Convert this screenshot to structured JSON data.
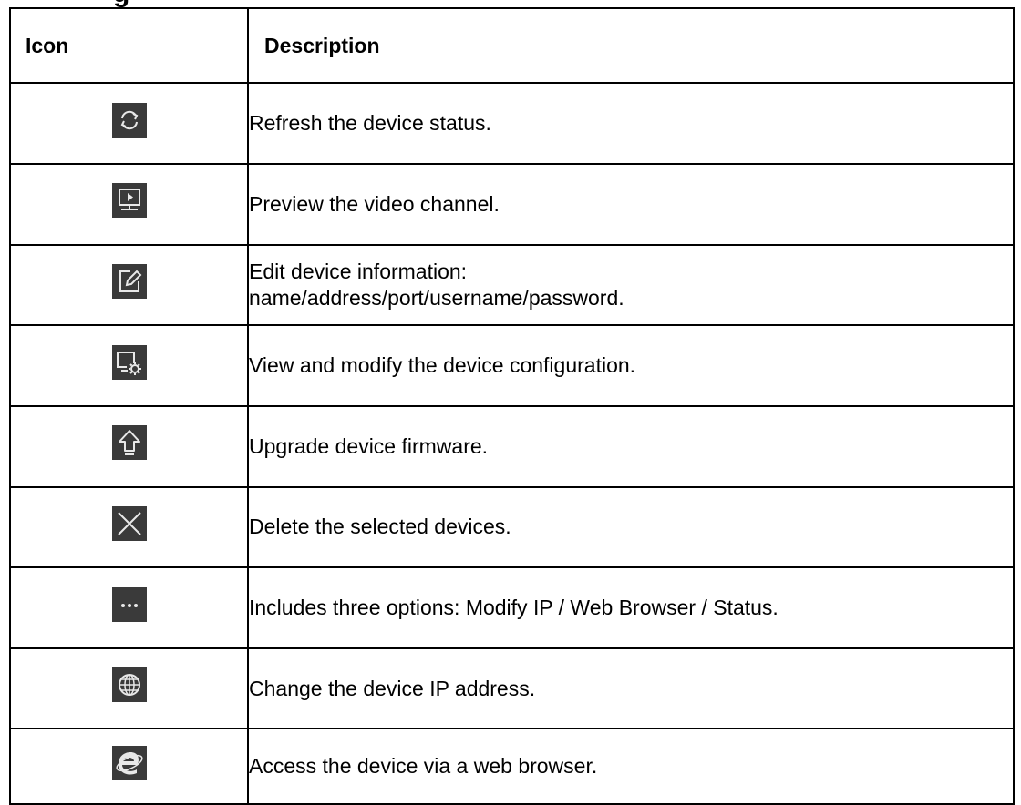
{
  "heading_fragment": "g",
  "table": {
    "headers": {
      "icon": "Icon",
      "description": "Description"
    },
    "rows": [
      {
        "icon": "refresh-icon",
        "description": "Refresh the device status."
      },
      {
        "icon": "preview-video-icon",
        "description": "Preview the video channel."
      },
      {
        "icon": "edit-icon",
        "description": "Edit device information:\nname/address/port/username/password."
      },
      {
        "icon": "device-config-icon",
        "description": "View and modify the device configuration."
      },
      {
        "icon": "upgrade-icon",
        "description": "Upgrade device firmware."
      },
      {
        "icon": "delete-icon",
        "description": "Delete the selected devices."
      },
      {
        "icon": "more-options-icon",
        "description": "Includes three options: Modify IP / Web Browser / Status."
      },
      {
        "icon": "globe-icon",
        "description": "Change the device IP address."
      },
      {
        "icon": "web-browser-icon",
        "description": "Access the device via a web browser."
      }
    ]
  },
  "colors": {
    "icon_background": "#3a3a3a",
    "icon_foreground": "#e8e8e8",
    "border": "#000000"
  }
}
